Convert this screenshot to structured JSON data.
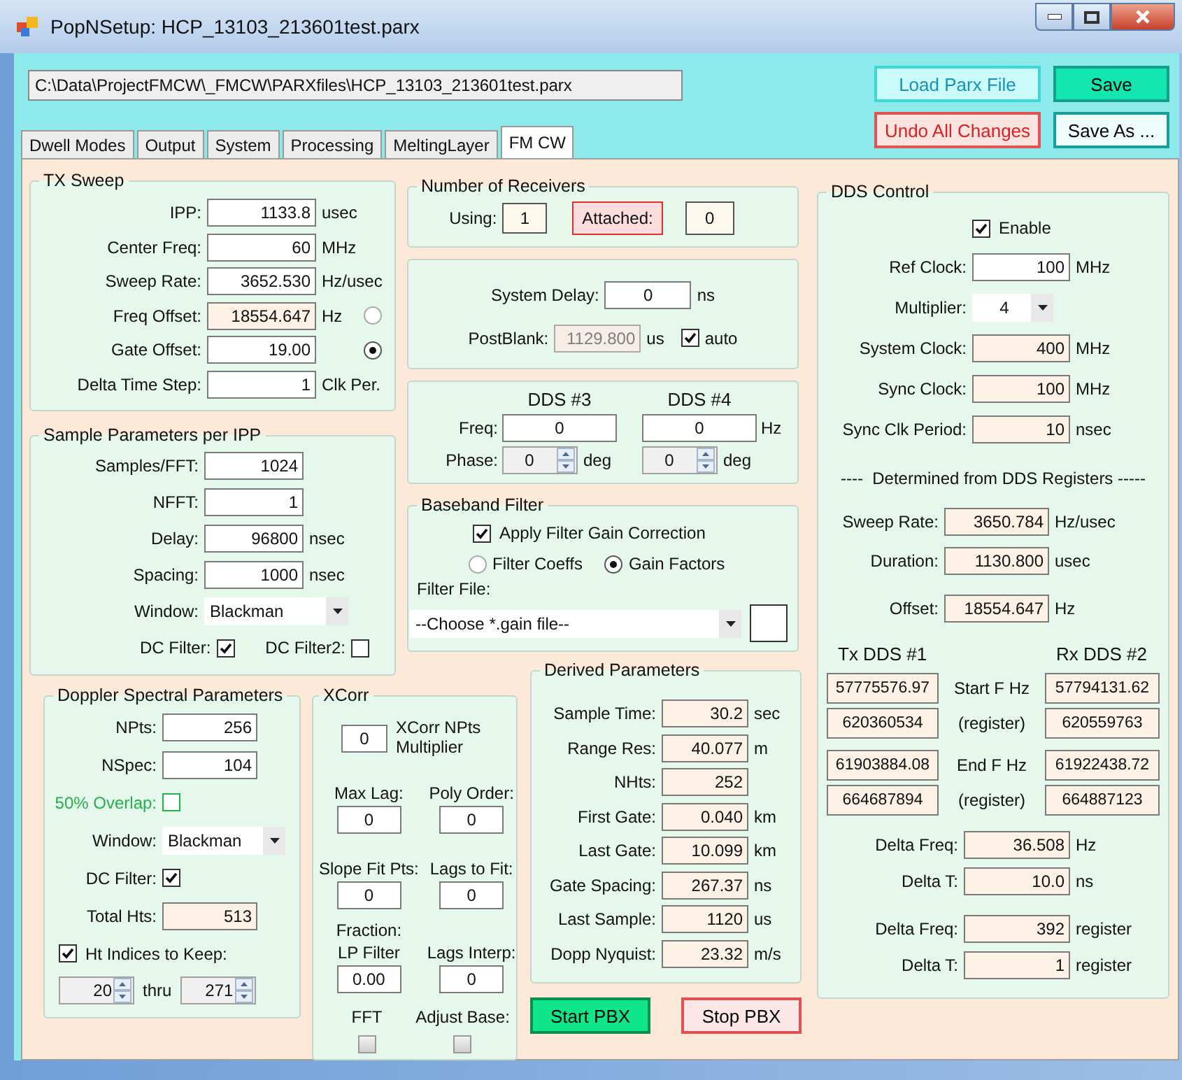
{
  "window": {
    "title": "PopNSetup: HCP_13103_213601test.parx"
  },
  "file_path": {
    "value": "C:\\Data\\ProjectFMCW\\_FMCW\\PARXfiles\\HCP_13103_213601test.parx"
  },
  "buttons": [
    {
      "label": "Load Parx File",
      "kind": "load"
    },
    {
      "label": "Save",
      "kind": "save"
    },
    {
      "label": "Undo All Changes",
      "kind": "undo"
    },
    {
      "label": "Save As ...",
      "kind": "saveas"
    }
  ],
  "tabs": [
    {
      "label": "Dwell Modes",
      "selected": false
    },
    {
      "label": "Output",
      "selected": false
    },
    {
      "label": "System",
      "selected": false
    },
    {
      "label": "Processing",
      "selected": false
    },
    {
      "label": "MeltingLayer",
      "selected": false
    },
    {
      "label": "FM CW",
      "selected": true
    }
  ],
  "tx_sweep": {
    "title": "TX Sweep",
    "rows": [
      {
        "label": "IPP:",
        "value": "1133.8",
        "unit": "usec",
        "kind": "input"
      },
      {
        "label": "Center Freq:",
        "value": "60",
        "unit": "MHz",
        "kind": "input"
      },
      {
        "label": "Sweep Rate:",
        "value": "3652.530",
        "unit": "Hz/usec",
        "kind": "input"
      },
      {
        "label": "Freq Offset:",
        "value": "18554.647",
        "unit": "Hz",
        "kind": "readonly",
        "selected": false
      },
      {
        "label": "Gate Offset:",
        "value": "19.00",
        "kind": "input",
        "selected": true
      },
      {
        "label": "Delta Time Step:",
        "value": "1",
        "unit": "Clk Per.",
        "kind": "input"
      }
    ]
  },
  "sample_params": {
    "title": "Sample Parameters per IPP",
    "rows": [
      {
        "label": "Samples/FFT:",
        "value": "1024",
        "kind": "input"
      },
      {
        "label": "NFFT:",
        "value": "1",
        "kind": "input"
      },
      {
        "label": "Delay:",
        "value": "96800",
        "unit": "nsec",
        "kind": "input"
      },
      {
        "label": "Spacing:",
        "value": "1000",
        "unit": "nsec",
        "kind": "input"
      },
      {
        "label": "Window:",
        "value": "Blackman",
        "kind": "combo"
      }
    ],
    "checks": [
      {
        "label": "DC Filter:",
        "checked": true
      },
      {
        "label": "DC Filter2:",
        "checked": false
      }
    ]
  },
  "receivers": {
    "title": "Number of Receivers",
    "using": {
      "label": "Using:",
      "value": "1"
    },
    "attached": {
      "label": "Attached:",
      "value": "0"
    }
  },
  "timing": {
    "rows": [
      {
        "label": "System Delay:",
        "value": "0",
        "unit": "ns",
        "kind": "input"
      },
      {
        "label": "PostBlank:",
        "value": "1129.800",
        "unit": "us",
        "kind": "disabled",
        "check": {
          "label": "auto",
          "checked": true
        }
      }
    ]
  },
  "dds34": {
    "freq_label": "Freq:",
    "freq_unit": "Hz",
    "phase_label": "Phase:",
    "columns": [
      {
        "label": "DDS #3",
        "freq": "0",
        "phase": "0",
        "phase_unit": "deg"
      },
      {
        "label": "DDS #4",
        "freq": "0",
        "phase": "0",
        "phase_unit": "deg"
      }
    ]
  },
  "baseband": {
    "title": "Baseband Filter",
    "gain_correction": {
      "label": "Apply Filter Gain Correction",
      "checked": true
    },
    "options": [
      {
        "label": "Filter Coeffs",
        "selected": false
      },
      {
        "label": "Gain Factors",
        "selected": true
      }
    ],
    "file_label": "Filter File:",
    "file_combo": {
      "value": "--Choose *.gain file--"
    }
  },
  "doppler": {
    "title": "Doppler Spectral Parameters",
    "rows": [
      {
        "label": "NPts:",
        "value": "256",
        "kind": "input"
      },
      {
        "label": "NSpec:",
        "value": "104",
        "kind": "input"
      },
      {
        "label": "50% Overlap:",
        "checked": false,
        "kind": "check",
        "color": "#22b14c"
      },
      {
        "label": "Window:",
        "value": "Blackman",
        "kind": "combo"
      },
      {
        "label": "DC Filter:",
        "checked": true,
        "kind": "check"
      },
      {
        "label": "Total Hts:",
        "value": "513",
        "kind": "readonly"
      }
    ],
    "keep": {
      "label": "Ht Indices to Keep:",
      "checked": true
    },
    "range": {
      "from": "20",
      "to_label": "thru",
      "to": "271"
    }
  },
  "xcorr": {
    "title": "XCorr",
    "multiplier": {
      "value": "0",
      "label": "XCorr NPts Multiplier"
    },
    "cells": [
      {
        "label": "Max Lag:",
        "value": "0"
      },
      {
        "label": "Poly Order:",
        "value": "0"
      },
      {
        "label": "Slope Fit Pts:",
        "value": "0"
      },
      {
        "label": "Lags to Fit:",
        "value": "0"
      },
      {
        "note": "Fraction:",
        "label": "LP Filter",
        "value": "0.00"
      },
      {
        "label": "Lags Interp:",
        "value": "0"
      }
    ],
    "checks": [
      {
        "label": "FFT",
        "checked": false,
        "disabled": true
      },
      {
        "label": "Adjust Base:",
        "checked": false,
        "disabled": true
      }
    ]
  },
  "derived": {
    "title": "Derived Parameters",
    "rows": [
      {
        "label": "Sample Time:",
        "value": "30.2",
        "unit": "sec",
        "kind": "readonly"
      },
      {
        "label": "Range Res:",
        "value": "40.077",
        "unit": "m",
        "kind": "readonly"
      },
      {
        "label": "NHts:",
        "value": "252",
        "kind": "readonly"
      },
      {
        "label": "First Gate:",
        "value": "0.040",
        "unit": "km",
        "kind": "readonly"
      },
      {
        "label": "Last Gate:",
        "value": "10.099",
        "unit": "km",
        "kind": "readonly"
      },
      {
        "label": "Gate Spacing:",
        "value": "267.37",
        "unit": "ns",
        "kind": "readonly"
      },
      {
        "label": "Last Sample:",
        "value": "1120",
        "unit": "us",
        "kind": "readonly"
      },
      {
        "label": "Dopp Nyquist:",
        "value": "23.32",
        "unit": "m/s",
        "kind": "readonly"
      }
    ]
  },
  "pbx_buttons": [
    {
      "label": "Start PBX",
      "kind": "start"
    },
    {
      "label": "Stop PBX",
      "kind": "stop"
    }
  ],
  "dds_control": {
    "title": "DDS Control",
    "enable": {
      "label": "Enable",
      "checked": true
    },
    "rows": [
      {
        "label": "Ref Clock:",
        "value": "100",
        "unit": "MHz",
        "kind": "input"
      },
      {
        "label": "Multiplier:",
        "value": "4",
        "kind": "combo"
      },
      {
        "label": "System Clock:",
        "value": "400",
        "unit": "MHz",
        "kind": "readonly"
      },
      {
        "label": "Sync Clock:",
        "value": "100",
        "unit": "MHz",
        "kind": "readonly"
      },
      {
        "label": "Sync Clk Period:",
        "value": "10",
        "unit": "nsec",
        "kind": "readonly"
      }
    ],
    "registers_heading": "----  Determined from DDS Registers -----",
    "derived_rows": [
      {
        "label": "Sweep Rate:",
        "value": "3650.784",
        "unit": "Hz/usec",
        "kind": "readonly"
      },
      {
        "label": "Duration:",
        "value": "1130.800",
        "unit": "usec",
        "kind": "readonly"
      },
      {
        "label": "Offset:",
        "value": "18554.647",
        "unit": "Hz",
        "kind": "readonly"
      }
    ],
    "tx_heading": "Tx DDS #1",
    "rx_heading": "Rx DDS #2",
    "register_groups": [
      {
        "rows": [
          {
            "tx": "57775576.97",
            "label": "Start F Hz",
            "rx": "57794131.62"
          },
          {
            "tx": "620360534",
            "label": "(register)",
            "rx": "620559763"
          }
        ]
      },
      {
        "rows": [
          {
            "tx": "61903884.08",
            "label": "End F Hz",
            "rx": "61922438.72"
          },
          {
            "tx": "664687894",
            "label": "(register)",
            "rx": "664887123"
          }
        ]
      }
    ],
    "delta_groups": [
      {
        "rows": [
          {
            "label": "Delta Freq:",
            "value": "36.508",
            "unit": "Hz",
            "kind": "readonly"
          },
          {
            "label": "Delta T:",
            "value": "10.0",
            "unit": "ns",
            "kind": "readonly"
          }
        ]
      },
      {
        "rows": [
          {
            "label": "Delta Freq:",
            "value": "392",
            "unit": "register",
            "kind": "readonly"
          },
          {
            "label": "Delta T:",
            "value": "1",
            "unit": "register",
            "kind": "readonly"
          }
        ]
      }
    ]
  }
}
